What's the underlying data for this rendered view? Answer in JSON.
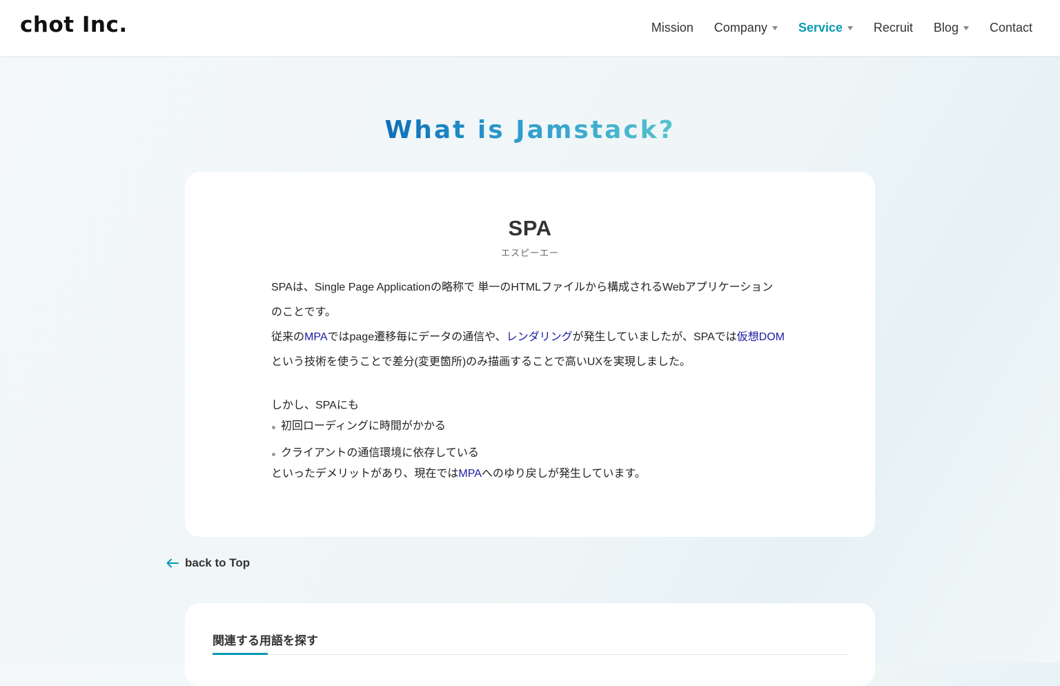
{
  "header": {
    "logo": "chot Inc.",
    "nav": [
      {
        "label": "Mission"
      },
      {
        "label": "Company"
      },
      {
        "label": "Service"
      },
      {
        "label": "Recruit"
      },
      {
        "label": "Blog"
      },
      {
        "label": "Contact"
      }
    ]
  },
  "hero": {
    "title": "What is Jamstack?"
  },
  "term": {
    "name": "SPA",
    "reading": "エスピーエー",
    "p1_line1": "SPAは、Single Page Applicationの略称で 単一のHTMLファイルから構成されるWebアプリケーション",
    "p1_line2": "のことです。",
    "p2_a": "従来の",
    "p2_link1": "MPA",
    "p2_b": "ではpage遷移毎にデータの通信や、",
    "p2_link2": "レンダリング",
    "p2_c": "が発生していましたが、SPAでは",
    "p2_link3": "仮想DOM",
    "p2_line2": "という技術を使うことで差分(変更箇所)のみ描画することで高いUXを実現しました。",
    "p3_intro": "しかし、SPAにも",
    "bullets": [
      "初回ローディングに時間がかかる",
      "クライアントの通信環境に依存している"
    ],
    "p4_a": "といったデメリットがあり、現在では",
    "p4_link": "MPA",
    "p4_b": "へのゆり戻しが発生しています。"
  },
  "back": {
    "label": "back to Top",
    "icon": "arrow-left-icon"
  },
  "related": {
    "title": "関連する用語を探す"
  },
  "colors": {
    "accent": "#0a9ab3",
    "link": "#1a1aa6"
  }
}
